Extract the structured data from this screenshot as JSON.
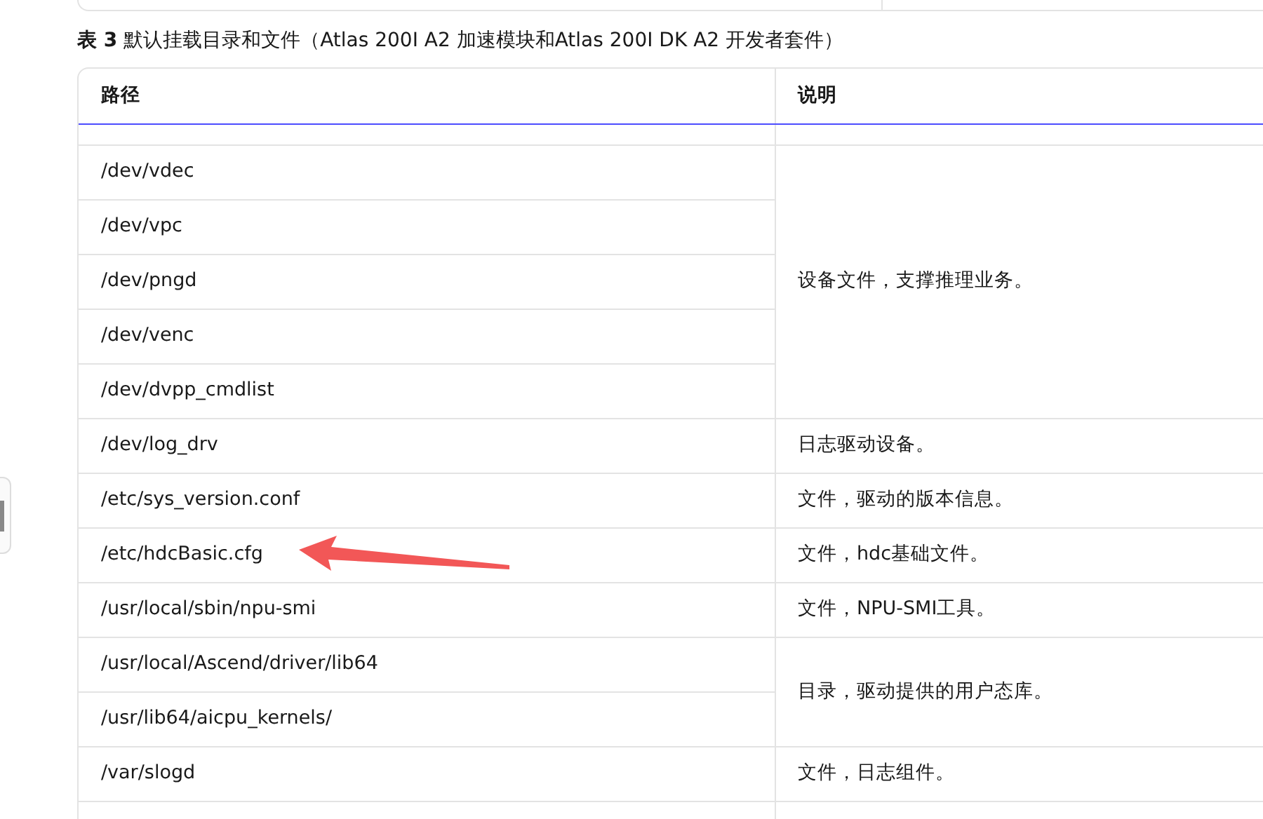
{
  "caption": "**表 3** 默认挂载目录和文件（Atlas 200I A2 加速模块和Atlas 200I DK A2 开发者套件）",
  "table": {
    "columns": [
      "路径",
      "说明"
    ],
    "groups": [
      {
        "paths": [
          "/dev/vdec",
          "/dev/vpc",
          "/dev/pngd",
          "/dev/venc",
          "/dev/dvpp_cmdlist"
        ],
        "description": "设备文件，支撑推理业务。"
      },
      {
        "paths": [
          "/dev/log_drv"
        ],
        "description": "日志驱动设备。"
      },
      {
        "paths": [
          "/etc/sys_version.conf"
        ],
        "description": "文件，驱动的版本信息。"
      },
      {
        "paths": [
          "/etc/hdcBasic.cfg"
        ],
        "description": "文件，hdc基础文件。"
      },
      {
        "paths": [
          "/usr/local/sbin/npu-smi"
        ],
        "description": "文件，NPU-SMI工具。"
      },
      {
        "paths": [
          "/usr/local/Ascend/driver/lib64",
          "/usr/lib64/aicpu_kernels/"
        ],
        "description": "目录，驱动提供的用户态库。"
      },
      {
        "paths": [
          "/var/slogd"
        ],
        "description": "文件，日志组件。"
      }
    ]
  }
}
